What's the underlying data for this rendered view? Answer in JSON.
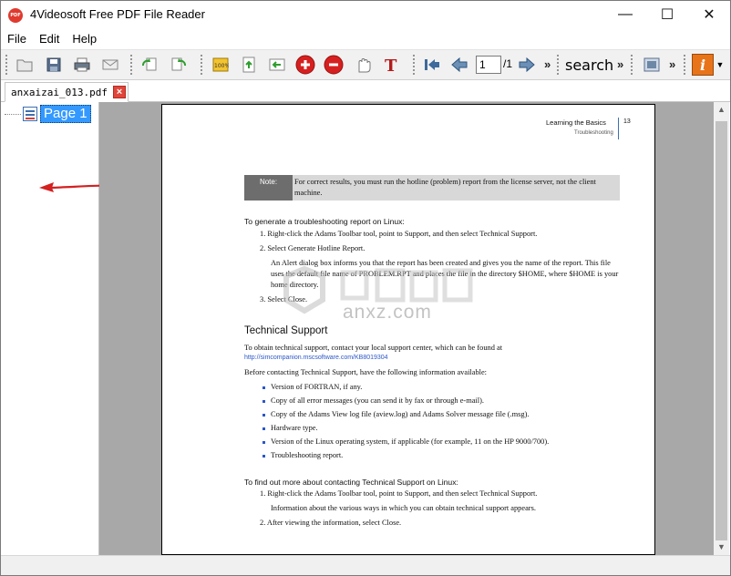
{
  "window": {
    "title": "4Videosoft Free PDF File Reader",
    "logo_text": "PDF"
  },
  "window_controls": {
    "minimize": "—",
    "maximize": "☐",
    "close": "✕"
  },
  "menu": [
    "File",
    "Edit",
    "Help"
  ],
  "toolbar": {
    "current_page": "1",
    "total_pages": "/1",
    "search_label": "search",
    "more": "»",
    "help_badge": "i"
  },
  "tab": {
    "filename": "anxaizai_013.pdf",
    "close": "×"
  },
  "sidebar": {
    "page_label": "Page 1"
  },
  "pdf_page": {
    "chapter": "Learning the Basics",
    "section": "Troubleshooting",
    "number": "13",
    "note_label": "Note:",
    "note_text": "For correct results, you must run the hotline (problem) report from the license server, not the client machine.",
    "generate_heading": "To generate a troubleshooting report on Linux:",
    "gen_steps": [
      "1.  Right-click the Adams Toolbar tool, point to Support, and then select Technical Support.",
      "2.  Select Generate Hotline Report.",
      "3.  Select Close."
    ],
    "gen_para": "An Alert dialog box informs you that the report has been created and gives you the name of the report. This file uses the default file name of PROBLEM.RPT and places the file in the directory $HOME, where $HOME is your home directory.",
    "tech_heading": "Technical Support",
    "tech_intro": "To obtain technical support, contact your local support center, which can be found at",
    "tech_link": "http://simcompanion.mscsoftware.com/KB8019304",
    "before_text": "Before contacting Technical Support, have the following information available:",
    "bullets": [
      "Version of FORTRAN, if any.",
      "Copy of all error messages (you can send it by fax or through e-mail).",
      "Copy of the Adams View log file (aview.log) and Adams Solver message file (.msg).",
      "Hardware type.",
      "Version of the Linux operating system, if applicable (for example, 11 on the HP 9000/700).",
      "Troubleshooting report."
    ],
    "findout_heading": "To find out more about contacting Technical Support on Linux:",
    "find_steps": [
      "1.  Right-click the Adams Toolbar tool, point to Support, and then select Technical Support.",
      "2.  After viewing the information, select Close."
    ],
    "find_para": "Information about the various ways in which you can obtain technical support appears."
  },
  "watermark": {
    "text": "anxz.com"
  },
  "colors": {
    "accent": "#3399ff",
    "arrow": "#d42020",
    "tab_close": "#e0453a",
    "viewer_bg": "#a8a8a8",
    "link": "#2b57c7"
  }
}
